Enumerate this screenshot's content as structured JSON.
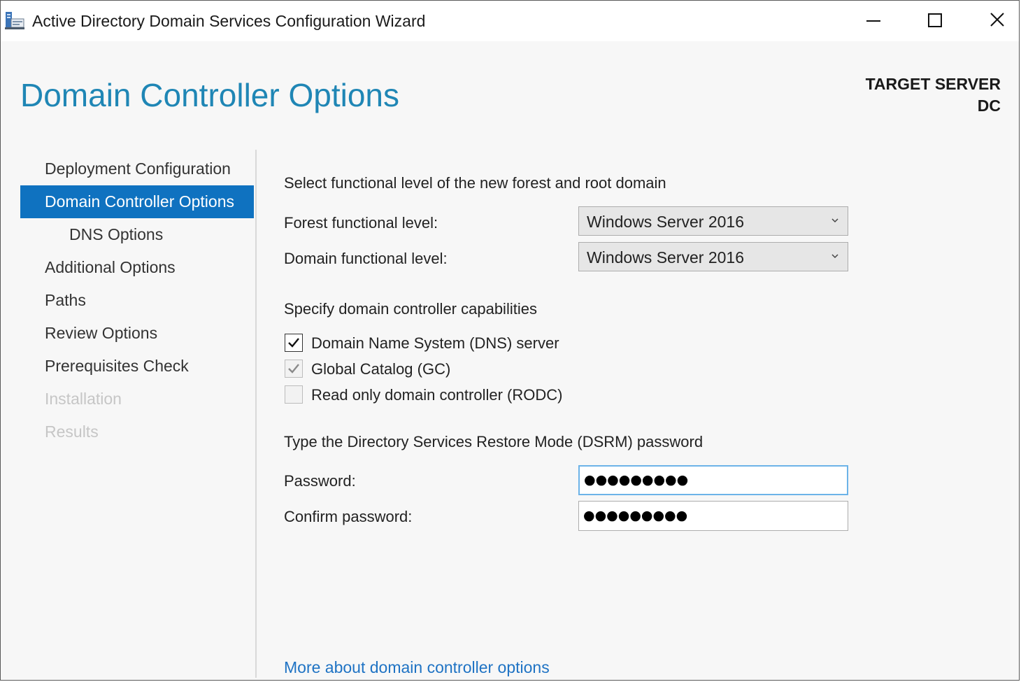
{
  "window": {
    "title": "Active Directory Domain Services Configuration Wizard",
    "icon": "server-manager-icon"
  },
  "header": {
    "page_title": "Domain Controller Options",
    "target_server_label": "TARGET SERVER",
    "target_server_name": "DC"
  },
  "nav": {
    "items": [
      {
        "label": "Deployment Configuration",
        "state": "normal"
      },
      {
        "label": "Domain Controller Options",
        "state": "selected"
      },
      {
        "label": "DNS Options",
        "state": "sub"
      },
      {
        "label": "Additional Options",
        "state": "normal"
      },
      {
        "label": "Paths",
        "state": "normal"
      },
      {
        "label": "Review Options",
        "state": "normal"
      },
      {
        "label": "Prerequisites Check",
        "state": "normal"
      },
      {
        "label": "Installation",
        "state": "disabled"
      },
      {
        "label": "Results",
        "state": "disabled"
      }
    ]
  },
  "functional_level": {
    "heading": "Select functional level of the new forest and root domain",
    "forest_label": "Forest functional level:",
    "forest_value": "Windows Server 2016",
    "domain_label": "Domain functional level:",
    "domain_value": "Windows Server 2016"
  },
  "capabilities": {
    "heading": "Specify domain controller capabilities",
    "dns_label": "Domain Name System (DNS) server",
    "dns_checked": true,
    "gc_label": "Global Catalog (GC)",
    "gc_checked": true,
    "rodc_label": "Read only domain controller (RODC)",
    "rodc_checked": false
  },
  "dsrm": {
    "heading": "Type the Directory Services Restore Mode (DSRM) password",
    "password_label": "Password:",
    "password_value": "●●●●●●●●●",
    "confirm_label": "Confirm password:",
    "confirm_value": "●●●●●●●●●"
  },
  "more_link": "More about domain controller options",
  "colors": {
    "accent": "#1f86b5",
    "selected": "#0f72c0",
    "link": "#1f73c4"
  }
}
